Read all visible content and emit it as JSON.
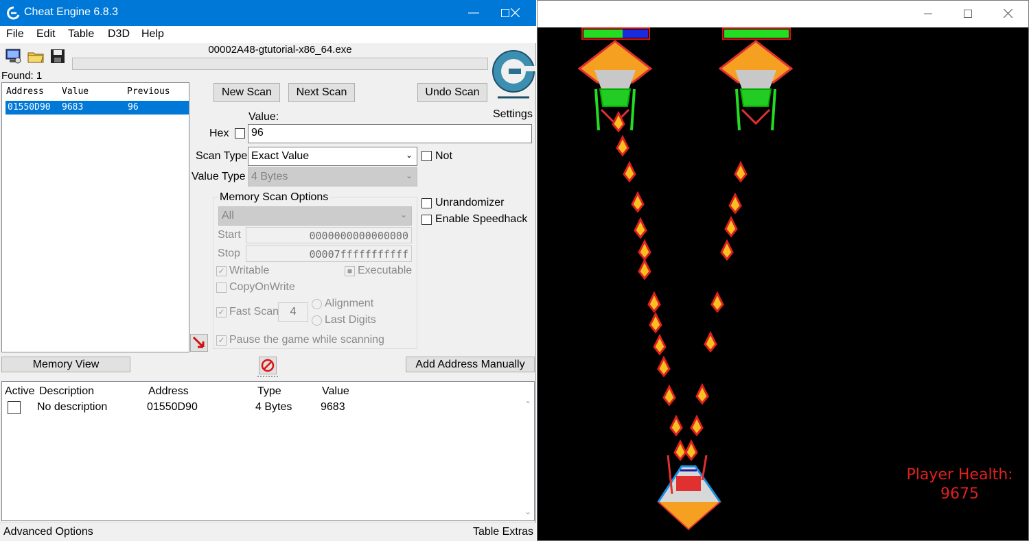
{
  "ce": {
    "title": "Cheat Engine 6.8.3",
    "menu": [
      "File",
      "Edit",
      "Table",
      "D3D",
      "Help"
    ],
    "process": "00002A48-gtutorial-x86_64.exe",
    "settings_label": "Settings",
    "found_label": "Found:",
    "found_count": "1",
    "results": {
      "headers": [
        "Address",
        "Value",
        "Previous"
      ],
      "rows": [
        {
          "address": "01550D90",
          "value": "9683",
          "previous": "96"
        }
      ]
    },
    "buttons": {
      "new_scan": "New Scan",
      "next_scan": "Next Scan",
      "undo_scan": "Undo Scan",
      "memory_view": "Memory View",
      "add_address": "Add Address Manually"
    },
    "value_label": "Value:",
    "hex_label": "Hex",
    "value_input": "96",
    "scan_type_label": "Scan Type",
    "scan_type": "Exact Value",
    "not_label": "Not",
    "value_type_label": "Value Type",
    "value_type": "4 Bytes",
    "mem_options": {
      "title": "Memory Scan Options",
      "region": "All",
      "start_label": "Start",
      "start": "0000000000000000",
      "stop_label": "Stop",
      "stop": "00007fffffffffff",
      "writable": "Writable",
      "executable": "Executable",
      "copy_on_write": "CopyOnWrite",
      "fast_scan": "Fast Scan",
      "fast_scan_value": "4",
      "alignment": "Alignment",
      "last_digits": "Last Digits",
      "pause": "Pause the game while scanning"
    },
    "unrandomizer": "Unrandomizer",
    "speedhack": "Enable Speedhack",
    "table": {
      "headers": [
        "Active",
        "Description",
        "Address",
        "Type",
        "Value"
      ],
      "rows": [
        {
          "description": "No description",
          "address": "01550D90",
          "type": "4 Bytes",
          "value": "9683"
        }
      ]
    },
    "status_left": "Advanced Options",
    "status_right": "Table Extras"
  },
  "game": {
    "health_label": "Player Health:",
    "health_value": "9675",
    "colors": {
      "health_text": "#e02020",
      "bar_green": "#22dd22",
      "bar_blue": "#1a2bdd",
      "bar_border": "#dd1111"
    }
  }
}
